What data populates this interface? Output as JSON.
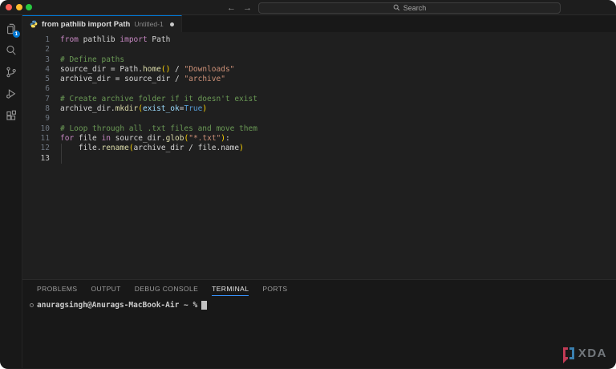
{
  "window": {
    "search_placeholder": "Search"
  },
  "activity_bar": {
    "items": [
      {
        "name": "explorer",
        "badge": "1"
      },
      {
        "name": "search"
      },
      {
        "name": "source-control"
      },
      {
        "name": "run-and-debug"
      },
      {
        "name": "extensions"
      }
    ]
  },
  "tab": {
    "title": "from pathlib import Path",
    "description": "Untitled-1",
    "modified": true
  },
  "editor": {
    "current_line": 13,
    "lines": [
      {
        "n": 1,
        "tokens": [
          {
            "t": "from",
            "c": "keyword"
          },
          {
            "t": " pathlib ",
            "c": "plain"
          },
          {
            "t": "import",
            "c": "keyword"
          },
          {
            "t": " Path",
            "c": "plain"
          }
        ]
      },
      {
        "n": 2,
        "tokens": []
      },
      {
        "n": 3,
        "tokens": [
          {
            "t": "# Define paths",
            "c": "comment"
          }
        ]
      },
      {
        "n": 4,
        "tokens": [
          {
            "t": "source_dir = Path.",
            "c": "plain"
          },
          {
            "t": "home",
            "c": "function"
          },
          {
            "t": "()",
            "c": "bracket"
          },
          {
            "t": " / ",
            "c": "plain"
          },
          {
            "t": "\"Downloads\"",
            "c": "string"
          }
        ]
      },
      {
        "n": 5,
        "tokens": [
          {
            "t": "archive_dir = source_dir / ",
            "c": "plain"
          },
          {
            "t": "\"archive\"",
            "c": "string"
          }
        ]
      },
      {
        "n": 6,
        "tokens": []
      },
      {
        "n": 7,
        "tokens": [
          {
            "t": "# Create archive folder if it doesn't exist",
            "c": "comment"
          }
        ]
      },
      {
        "n": 8,
        "tokens": [
          {
            "t": "archive_dir.",
            "c": "plain"
          },
          {
            "t": "mkdir",
            "c": "function"
          },
          {
            "t": "(",
            "c": "bracket"
          },
          {
            "t": "exist_ok",
            "c": "parameter"
          },
          {
            "t": "=",
            "c": "plain"
          },
          {
            "t": "True",
            "c": "constant"
          },
          {
            "t": ")",
            "c": "bracket"
          }
        ]
      },
      {
        "n": 9,
        "tokens": []
      },
      {
        "n": 10,
        "tokens": [
          {
            "t": "# Loop through all .txt files and move them",
            "c": "comment"
          }
        ]
      },
      {
        "n": 11,
        "tokens": [
          {
            "t": "for",
            "c": "keyword"
          },
          {
            "t": " file ",
            "c": "plain"
          },
          {
            "t": "in",
            "c": "keyword"
          },
          {
            "t": " source_dir.",
            "c": "plain"
          },
          {
            "t": "glob",
            "c": "function"
          },
          {
            "t": "(",
            "c": "bracket"
          },
          {
            "t": "\"*.txt\"",
            "c": "string"
          },
          {
            "t": ")",
            "c": "bracket"
          },
          {
            "t": ":",
            "c": "plain"
          }
        ]
      },
      {
        "n": 12,
        "tokens": [
          {
            "t": "    file.",
            "c": "plain"
          },
          {
            "t": "rename",
            "c": "function"
          },
          {
            "t": "(",
            "c": "bracket"
          },
          {
            "t": "archive_dir / file.name",
            "c": "plain"
          },
          {
            "t": ")",
            "c": "bracket"
          }
        ],
        "guide": true
      },
      {
        "n": 13,
        "tokens": [],
        "guide": true
      }
    ]
  },
  "panel": {
    "tabs": [
      {
        "label": "PROBLEMS",
        "active": false
      },
      {
        "label": "OUTPUT",
        "active": false
      },
      {
        "label": "DEBUG CONSOLE",
        "active": false
      },
      {
        "label": "TERMINAL",
        "active": true
      },
      {
        "label": "PORTS",
        "active": false
      }
    ],
    "terminal": {
      "prompt": "anuragsingh@Anurags-MacBook-Air ~ %"
    }
  },
  "watermark": {
    "text": "XDA"
  },
  "colors": {
    "accent": "#0078d4",
    "keyword": "#c586c0",
    "comment": "#6a9955",
    "string": "#ce9178",
    "function": "#dcdcaa",
    "bracket": "#ffd602",
    "parameter": "#9cdcfe",
    "constant": "#569cd6",
    "plain": "#d4d4d4",
    "editor_bg": "#1f1f1f",
    "chrome_bg": "#181818",
    "traffic_red": "#ff5f57",
    "traffic_yellow": "#febc2e",
    "traffic_green": "#28c840",
    "xda_red": "#c03b55",
    "xda_blue": "#3a7fae"
  }
}
